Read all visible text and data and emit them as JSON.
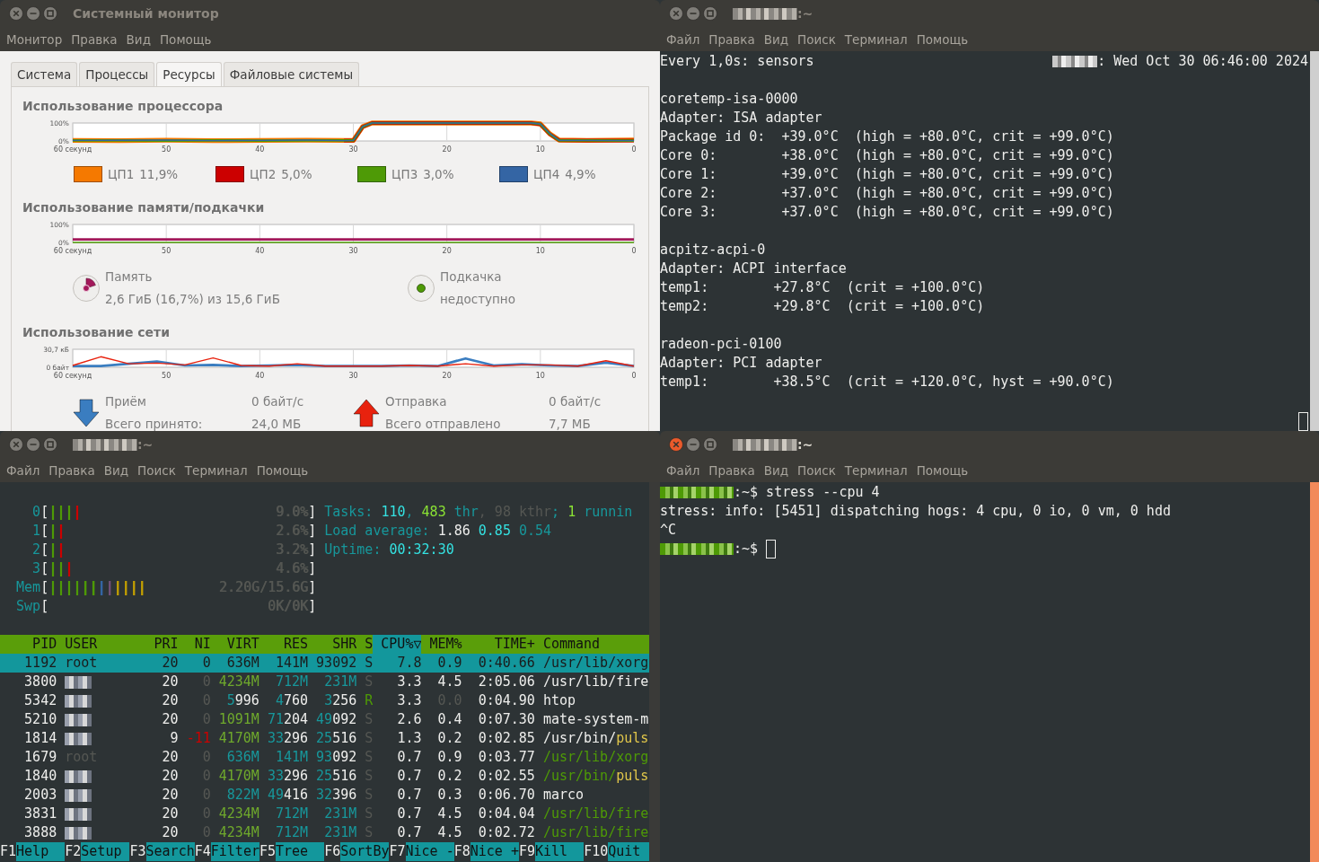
{
  "windows": [
    {
      "kind": "system_monitor",
      "active": false,
      "title": "Системный монитор",
      "menu": [
        "Монитор",
        "Правка",
        "Вид",
        "Помощь"
      ],
      "tabs": [
        {
          "label": "Система",
          "selected": false
        },
        {
          "label": "Процессы",
          "selected": false
        },
        {
          "label": "Ресурсы",
          "selected": true
        },
        {
          "label": "Файловые системы",
          "selected": false
        }
      ],
      "cpu": {
        "title": "Использование процессора",
        "chart_data": {
          "type": "line",
          "grid": true,
          "x": [
            60,
            55,
            50,
            45,
            40,
            35,
            31,
            30,
            29,
            28,
            20,
            11,
            10,
            9,
            8,
            5,
            0
          ],
          "xlim": [
            60,
            0
          ],
          "ylim": [
            0,
            100
          ],
          "xticks": [
            {
              "value": 60,
              "label": "60 секунд"
            },
            50,
            40,
            30,
            20,
            10,
            0
          ],
          "yticks": [
            {
              "value": 100,
              "label": "100%"
            },
            {
              "value": 0,
              "label": "0%"
            }
          ],
          "series": [
            {
              "name": "ЦП1",
              "color": "#f57900",
              "values": [
                3,
                2,
                4,
                2,
                3,
                4,
                3,
                3,
                80,
                100,
                100,
                100,
                95,
                40,
                5,
                3,
                6
              ]
            },
            {
              "name": "ЦП2",
              "color": "#cc0000",
              "values": [
                null,
                null,
                null,
                null,
                null,
                null,
                2,
                2,
                78,
                100,
                100,
                100,
                93,
                38,
                4,
                2,
                3
              ]
            },
            {
              "name": "ЦП3",
              "color": "#4e9a06",
              "values": [
                3,
                3,
                2,
                3,
                2,
                3,
                3,
                3,
                79,
                100,
                100,
                100,
                94,
                39,
                3,
                3,
                2
              ]
            },
            {
              "name": "ЦП4",
              "color": "#3465a4",
              "values": [
                3,
                4,
                5,
                2,
                3,
                5,
                2,
                3,
                81,
                100,
                100,
                100,
                95,
                42,
                4,
                3,
                2
              ]
            }
          ]
        },
        "readings": [
          "11,9%",
          "5,0%",
          "3,0%",
          "4,9%"
        ]
      },
      "memory": {
        "title": "Использование памяти/подкачки",
        "chart_data": {
          "type": "line",
          "grid": true,
          "x": [
            60,
            0
          ],
          "xlim": [
            60,
            0
          ],
          "ylim": [
            0,
            100
          ],
          "xticks": [
            {
              "value": 60,
              "label": "60 секунд"
            },
            50,
            40,
            30,
            20,
            10,
            0
          ],
          "yticks": [
            {
              "value": 100,
              "label": "100%"
            },
            {
              "value": 0,
              "label": "0%"
            }
          ],
          "series": [
            {
              "name": "Память",
              "color": "#a3195b",
              "values": [
                17,
                17
              ]
            },
            {
              "name": "Подкачка",
              "color": "#4e9a06",
              "values": [
                0,
                0
              ]
            }
          ]
        },
        "memory_value": "2,6 ГиБ (16,7%) из 15,6 ГиБ",
        "swap_value": "недоступно"
      },
      "network": {
        "title": "Использование сети",
        "chart_data": {
          "type": "line",
          "grid": true,
          "x": [
            60,
            57,
            54,
            51,
            48,
            45,
            42,
            39,
            36,
            33,
            30,
            27,
            24,
            21,
            18,
            15,
            12,
            9,
            6,
            3,
            0
          ],
          "xlim": [
            60,
            0
          ],
          "ylim": [
            0,
            30.7
          ],
          "xticks": [
            {
              "value": 60,
              "label": "60 секунд"
            },
            50,
            40,
            30,
            20,
            10,
            0
          ],
          "yticks": [
            {
              "value": 30.7,
              "label": "30,7 кБ"
            },
            {
              "value": 0,
              "label": "0 байт"
            }
          ],
          "series": [
            {
              "name": "Приём",
              "color": "#3a7dc0",
              "values": [
                2,
                2,
                6,
                10,
                3,
                4,
                2,
                3,
                4,
                2,
                2,
                2,
                3,
                2,
                15,
                3,
                5,
                3,
                2,
                8,
                2
              ]
            },
            {
              "name": "Отправка",
              "color": "#e8220e",
              "values": [
                3,
                18,
                6,
                7,
                4,
                16,
                3,
                2,
                6,
                2,
                2,
                2,
                3,
                2,
                6,
                2,
                4,
                4,
                2,
                11,
                2
              ]
            }
          ]
        },
        "traffic": [
          {
            "kind": "receive",
            "rate": "0 байт/с",
            "total_label": "Всего принято:",
            "total": "24,0 МБ"
          },
          {
            "kind": "send",
            "rate": "0 байт/с",
            "total_label": "Всего отправлено",
            "total": "7,7 МБ"
          }
        ]
      }
    },
    {
      "kind": "terminal",
      "active": false,
      "title": ":~",
      "title_redacted": true,
      "menu": [
        "Файл",
        "Правка",
        "Вид",
        "Поиск",
        "Терминал",
        "Помощь"
      ],
      "content": {
        "kind": "watch",
        "header": "Every 1,0s: sensors",
        "host_redacted": true,
        "clock": ": Wed Oct 30 06:46:00 2024",
        "cursor": true,
        "blocks": [
          [
            "coretemp-isa-0000",
            "Adapter: ISA adapter",
            "Package id 0:  +39.0°C  (high = +80.0°C, crit = +99.0°C)",
            "Core 0:        +38.0°C  (high = +80.0°C, crit = +99.0°C)",
            "Core 1:        +39.0°C  (high = +80.0°C, crit = +99.0°C)",
            "Core 2:        +37.0°C  (high = +80.0°C, crit = +99.0°C)",
            "Core 3:        +37.0°C  (high = +80.0°C, crit = +99.0°C)"
          ],
          [
            "acpitz-acpi-0",
            "Adapter: ACPI interface",
            "temp1:        +27.8°C  (crit = +100.0°C)",
            "temp2:        +29.8°C  (crit = +100.0°C)"
          ],
          [
            "radeon-pci-0100",
            "Adapter: PCI adapter",
            "temp1:        +38.5°C  (crit = +120.0°C, hyst = +90.0°C)"
          ]
        ]
      }
    },
    {
      "kind": "terminal",
      "active": false,
      "title": ":~",
      "title_redacted": true,
      "menu": [
        "Файл",
        "Правка",
        "Вид",
        "Поиск",
        "Терминал",
        "Помощь"
      ],
      "content": {
        "kind": "htop",
        "meters": [
          {
            "label": "0",
            "open": "[",
            "bars": [
              {
                "text": "|||",
                "color": "#4e9a06"
              },
              {
                "text": "|",
                "color": "#cc0000"
              }
            ],
            "value": "9.0%",
            "close": "]"
          },
          {
            "label": "1",
            "open": "[",
            "bars": [
              {
                "text": "|",
                "color": "#4e9a06"
              },
              {
                "text": "|",
                "color": "#cc0000"
              }
            ],
            "value": "2.6%",
            "close": "]"
          },
          {
            "label": "2",
            "open": "[",
            "bars": [
              {
                "text": "|",
                "color": "#4e9a06"
              },
              {
                "text": "|",
                "color": "#cc0000"
              }
            ],
            "value": "3.2%",
            "close": "]"
          },
          {
            "label": "3",
            "open": "[",
            "bars": [
              {
                "text": "||",
                "color": "#4e9a06"
              },
              {
                "text": "|",
                "color": "#cc0000"
              }
            ],
            "value": "4.6%",
            "close": "]"
          },
          {
            "label": "Mem",
            "open": "[",
            "bars": [
              {
                "text": "||||||",
                "color": "#4e9a06"
              },
              {
                "text": "|",
                "color": "#3465a4"
              },
              {
                "text": "|",
                "color": "#75507b"
              },
              {
                "text": "||||",
                "color": "#c4a000"
              }
            ],
            "value": "2.20G/15.6G",
            "close": "]"
          },
          {
            "label": "Swp",
            "open": "[",
            "value": "0K/0K",
            "close": "]"
          }
        ],
        "summary": [
          [
            {
              "text": "Tasks: ",
              "color": "#17979b"
            },
            {
              "text": "110",
              "color": "#34e2e2"
            },
            {
              "text": ", ",
              "color": "#17979b"
            },
            {
              "text": "483",
              "color": "#8ae234"
            },
            {
              "text": " thr",
              "color": "#17979b"
            },
            {
              "text": ", 98 kthr",
              "color": "#555753"
            },
            {
              "text": "; ",
              "color": "#17979b"
            },
            {
              "text": "1",
              "color": "#8ae234"
            },
            {
              "text": " runnin",
              "color": "#17979b"
            }
          ],
          [
            {
              "text": "Load average: ",
              "color": "#17979b"
            },
            {
              "text": "1.86",
              "color": "#eeeeec"
            },
            {
              "text": " 0.85",
              "color": "#34e2e2"
            },
            {
              "text": " 0.54",
              "color": "#17979b"
            }
          ],
          [
            {
              "text": "Uptime: ",
              "color": "#17979b"
            },
            {
              "text": "00:32:30",
              "color": "#34e2e2"
            }
          ]
        ],
        "columns": [
          {
            "label": "PID",
            "selected": false
          },
          {
            "label": "USER",
            "selected": false
          },
          {
            "label": "PRI",
            "selected": false
          },
          {
            "label": "NI",
            "selected": false
          },
          {
            "label": "VIRT",
            "selected": false
          },
          {
            "label": "RES",
            "selected": false
          },
          {
            "label": "SHR",
            "selected": false
          },
          {
            "label": "S",
            "selected": false
          },
          {
            "label": "CPU%▽",
            "selected": true
          },
          {
            "label": "MEM%",
            "selected": false
          },
          {
            "label": "TIME+",
            "selected": false
          },
          {
            "label": "Command",
            "selected": false
          }
        ],
        "rows": [
          {
            "selected": true,
            "cells": [
              "1192",
              "root",
              "20",
              "0",
              "636M",
              "141M",
              "93092",
              "S",
              "7.8",
              "0.9",
              "0:40.66",
              "/usr/lib/xorg"
            ]
          },
          {
            "selected": false,
            "cells": [
              "3800",
              {
                "redacted": true
              },
              "20",
              [
                {
                  "text": "0",
                  "color": "#555753"
                }
              ],
              [
                {
                  "text": "4234M",
                  "color": "#6fa92c"
                }
              ],
              [
                {
                  "text": "712M",
                  "color": "#17979b"
                }
              ],
              [
                {
                  "text": "231M",
                  "color": "#17979b"
                }
              ],
              [
                {
                  "text": "S",
                  "color": "#555753"
                }
              ],
              "3.3",
              "4.5",
              "2:05.06",
              "/usr/lib/fire"
            ]
          },
          {
            "selected": false,
            "cells": [
              "5342",
              {
                "redacted": true
              },
              "20",
              [
                {
                  "text": "0",
                  "color": "#555753"
                }
              ],
              [
                {
                  "text": "5",
                  "color": "#17979b"
                },
                {
                  "text": "996",
                  "color": "#eeeeec"
                }
              ],
              [
                {
                  "text": "4",
                  "color": "#17979b"
                },
                {
                  "text": "760",
                  "color": "#eeeeec"
                }
              ],
              [
                {
                  "text": "3",
                  "color": "#17979b"
                },
                {
                  "text": "256",
                  "color": "#eeeeec"
                }
              ],
              [
                {
                  "text": "R",
                  "color": "#4e9a06"
                }
              ],
              "3.3",
              [
                {
                  "text": "0.0",
                  "color": "#555753"
                }
              ],
              "0:04.90",
              "htop"
            ]
          },
          {
            "selected": false,
            "cells": [
              "5210",
              {
                "redacted": true
              },
              "20",
              [
                {
                  "text": "0",
                  "color": "#555753"
                }
              ],
              [
                {
                  "text": "1091M",
                  "color": "#6fa92c"
                }
              ],
              [
                {
                  "text": "71",
                  "color": "#17979b"
                },
                {
                  "text": "204",
                  "color": "#eeeeec"
                }
              ],
              [
                {
                  "text": "49",
                  "color": "#17979b"
                },
                {
                  "text": "092",
                  "color": "#eeeeec"
                }
              ],
              [
                {
                  "text": "S",
                  "color": "#555753"
                }
              ],
              "2.6",
              "0.4",
              "0:07.30",
              "mate-system-m"
            ]
          },
          {
            "selected": false,
            "cells": [
              "1814",
              {
                "redacted": true
              },
              "9",
              [
                {
                  "text": "-11",
                  "color": "#cc0000"
                }
              ],
              [
                {
                  "text": "4170M",
                  "color": "#6fa92c"
                }
              ],
              [
                {
                  "text": "33",
                  "color": "#17979b"
                },
                {
                  "text": "296",
                  "color": "#eeeeec"
                }
              ],
              [
                {
                  "text": "25",
                  "color": "#17979b"
                },
                {
                  "text": "516",
                  "color": "#eeeeec"
                }
              ],
              [
                {
                  "text": "S",
                  "color": "#555753"
                }
              ],
              "1.3",
              "0.2",
              "0:02.85",
              [
                {
                  "text": "/usr/bin/",
                  "color": "#eeeeec"
                },
                {
                  "text": "puls",
                  "color": "#e0c64a"
                }
              ]
            ]
          },
          {
            "selected": false,
            "cells": [
              "1679",
              [
                {
                  "text": "root",
                  "color": "#555753"
                }
              ],
              "20",
              [
                {
                  "text": "0",
                  "color": "#555753"
                }
              ],
              [
                {
                  "text": "636M",
                  "color": "#17979b"
                }
              ],
              [
                {
                  "text": "141M",
                  "color": "#17979b"
                }
              ],
              [
                {
                  "text": "93",
                  "color": "#17979b"
                },
                {
                  "text": "092",
                  "color": "#eeeeec"
                }
              ],
              [
                {
                  "text": "S",
                  "color": "#555753"
                }
              ],
              "0.7",
              "0.9",
              "0:03.77",
              [
                {
                  "text": "/usr/lib/xorg",
                  "color": "#4e9a06"
                }
              ]
            ]
          },
          {
            "selected": false,
            "cells": [
              "1840",
              {
                "redacted": true
              },
              "20",
              [
                {
                  "text": "0",
                  "color": "#555753"
                }
              ],
              [
                {
                  "text": "4170M",
                  "color": "#6fa92c"
                }
              ],
              [
                {
                  "text": "33",
                  "color": "#17979b"
                },
                {
                  "text": "296",
                  "color": "#eeeeec"
                }
              ],
              [
                {
                  "text": "25",
                  "color": "#17979b"
                },
                {
                  "text": "516",
                  "color": "#eeeeec"
                }
              ],
              [
                {
                  "text": "S",
                  "color": "#555753"
                }
              ],
              "0.7",
              "0.2",
              "0:02.55",
              [
                {
                  "text": "/usr/bin/",
                  "color": "#4e9a06"
                },
                {
                  "text": "puls",
                  "color": "#e0c64a"
                }
              ]
            ]
          },
          {
            "selected": false,
            "cells": [
              "2003",
              {
                "redacted": true
              },
              "20",
              [
                {
                  "text": "0",
                  "color": "#555753"
                }
              ],
              [
                {
                  "text": "822M",
                  "color": "#17979b"
                }
              ],
              [
                {
                  "text": "49",
                  "color": "#17979b"
                },
                {
                  "text": "416",
                  "color": "#eeeeec"
                }
              ],
              [
                {
                  "text": "32",
                  "color": "#17979b"
                },
                {
                  "text": "396",
                  "color": "#eeeeec"
                }
              ],
              [
                {
                  "text": "S",
                  "color": "#555753"
                }
              ],
              "0.7",
              "0.3",
              "0:06.70",
              "marco"
            ]
          },
          {
            "selected": false,
            "cells": [
              "3831",
              {
                "redacted": true
              },
              "20",
              [
                {
                  "text": "0",
                  "color": "#555753"
                }
              ],
              [
                {
                  "text": "4234M",
                  "color": "#6fa92c"
                }
              ],
              [
                {
                  "text": "712M",
                  "color": "#17979b"
                }
              ],
              [
                {
                  "text": "231M",
                  "color": "#17979b"
                }
              ],
              [
                {
                  "text": "S",
                  "color": "#555753"
                }
              ],
              "0.7",
              "4.5",
              "0:04.04",
              [
                {
                  "text": "/usr/lib/fire",
                  "color": "#4e9a06"
                }
              ]
            ]
          },
          {
            "selected": false,
            "cells": [
              "3888",
              {
                "redacted": true
              },
              "20",
              [
                {
                  "text": "0",
                  "color": "#555753"
                }
              ],
              [
                {
                  "text": "4234M",
                  "color": "#6fa92c"
                }
              ],
              [
                {
                  "text": "712M",
                  "color": "#17979b"
                }
              ],
              [
                {
                  "text": "231M",
                  "color": "#17979b"
                }
              ],
              [
                {
                  "text": "S",
                  "color": "#555753"
                }
              ],
              "0.7",
              "4.5",
              "0:02.72",
              [
                {
                  "text": "/usr/lib/fire",
                  "color": "#4e9a06"
                }
              ]
            ]
          }
        ],
        "function_keys": [
          {
            "key": "F1",
            "label": "Help"
          },
          {
            "key": "F2",
            "label": "Setup"
          },
          {
            "key": "F3",
            "label": "Search"
          },
          {
            "key": "F4",
            "label": "Filter"
          },
          {
            "key": "F5",
            "label": "Tree"
          },
          {
            "key": "F6",
            "label": "SortBy"
          },
          {
            "key": "F7",
            "label": "Nice -"
          },
          {
            "key": "F8",
            "label": "Nice +"
          },
          {
            "key": "F9",
            "label": "Kill"
          },
          {
            "key": "F10",
            "label": "Quit"
          }
        ]
      }
    },
    {
      "kind": "terminal",
      "active": true,
      "title": ":~",
      "title_redacted": true,
      "menu": [
        "Файл",
        "Правка",
        "Вид",
        "Поиск",
        "Терминал",
        "Помощь"
      ],
      "content": {
        "kind": "shell",
        "lines": [
          {
            "kind": "prompt",
            "prompt": ":~$",
            "command": "stress --cpu 4"
          },
          {
            "kind": "output",
            "text": "stress: info: [5451] dispatching hogs: 4 cpu, 0 io, 0 vm, 0 hdd"
          },
          {
            "kind": "output",
            "text": "^C"
          },
          {
            "kind": "prompt",
            "prompt": ":~$",
            "cursor": true
          }
        ]
      }
    }
  ]
}
